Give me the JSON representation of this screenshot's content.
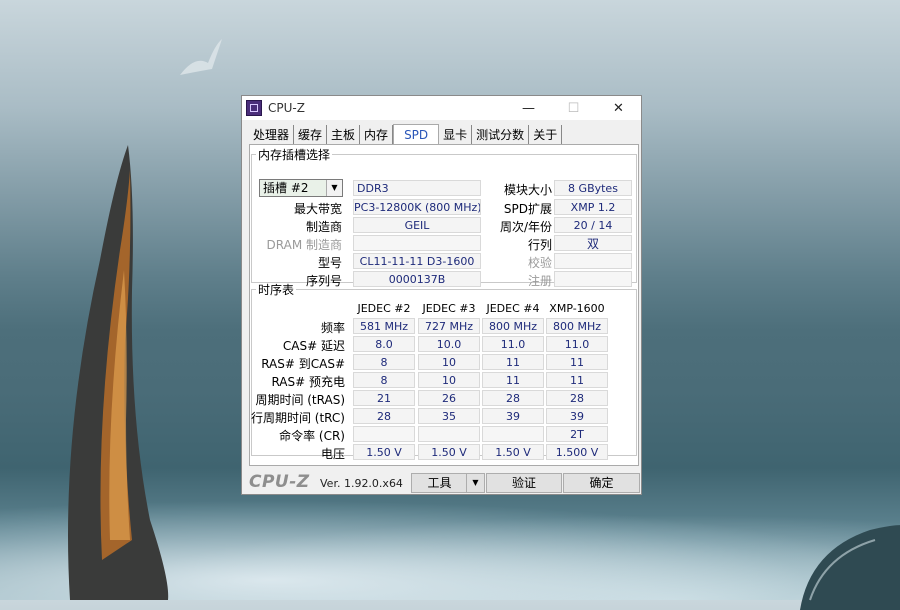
{
  "window": {
    "title": "CPU-Z"
  },
  "tabs": [
    "处理器",
    "缓存",
    "主板",
    "内存",
    "SPD",
    "显卡",
    "测试分数",
    "关于"
  ],
  "slot_section": {
    "legend": "内存插槽选择",
    "slot_selected": "插槽 #2",
    "memory_type": "DDR3",
    "module_size_label": "模块大小",
    "module_size": "8 GBytes",
    "max_bandwidth_label": "最大带宽",
    "max_bandwidth": "PC3-12800K (800 MHz)",
    "spd_ext_label": "SPD扩展",
    "spd_ext": "XMP 1.2",
    "manufacturer_label": "制造商",
    "manufacturer": "GEIL",
    "week_year_label": "周次/年份",
    "week_year": "20 / 14",
    "dram_mfr_label": "DRAM 制造商",
    "dram_mfr": "",
    "ranks_label": "行列",
    "ranks": "双",
    "part_number_label": "型号",
    "part_number": "CL11-11-11 D3-1600",
    "correction_label": "校验",
    "correction": "",
    "serial_label": "序列号",
    "serial": "0000137B",
    "registered_label": "注册",
    "registered": ""
  },
  "timings": {
    "legend": "时序表",
    "columns": [
      "JEDEC #2",
      "JEDEC #3",
      "JEDEC #4",
      "XMP-1600"
    ],
    "rows": [
      {
        "label": "频率",
        "values": [
          "581 MHz",
          "727 MHz",
          "800 MHz",
          "800 MHz"
        ]
      },
      {
        "label": "CAS# 延迟",
        "values": [
          "8.0",
          "10.0",
          "11.0",
          "11.0"
        ]
      },
      {
        "label": "RAS# 到CAS#",
        "values": [
          "8",
          "10",
          "11",
          "11"
        ]
      },
      {
        "label": "RAS# 预充电",
        "values": [
          "8",
          "10",
          "11",
          "11"
        ]
      },
      {
        "label": "周期时间 (tRAS)",
        "values": [
          "21",
          "26",
          "28",
          "28"
        ]
      },
      {
        "label": "行周期时间 (tRC)",
        "values": [
          "28",
          "35",
          "39",
          "39"
        ]
      },
      {
        "label": "命令率 (CR)",
        "values": [
          "",
          "",
          "",
          "2T"
        ]
      },
      {
        "label": "电压",
        "values": [
          "1.50 V",
          "1.50 V",
          "1.50 V",
          "1.500 V"
        ]
      }
    ]
  },
  "footer": {
    "logo": "CPU-Z",
    "version": "Ver. 1.92.0.x64",
    "tools_label": "工具",
    "validate_label": "验证",
    "ok_label": "确定"
  }
}
